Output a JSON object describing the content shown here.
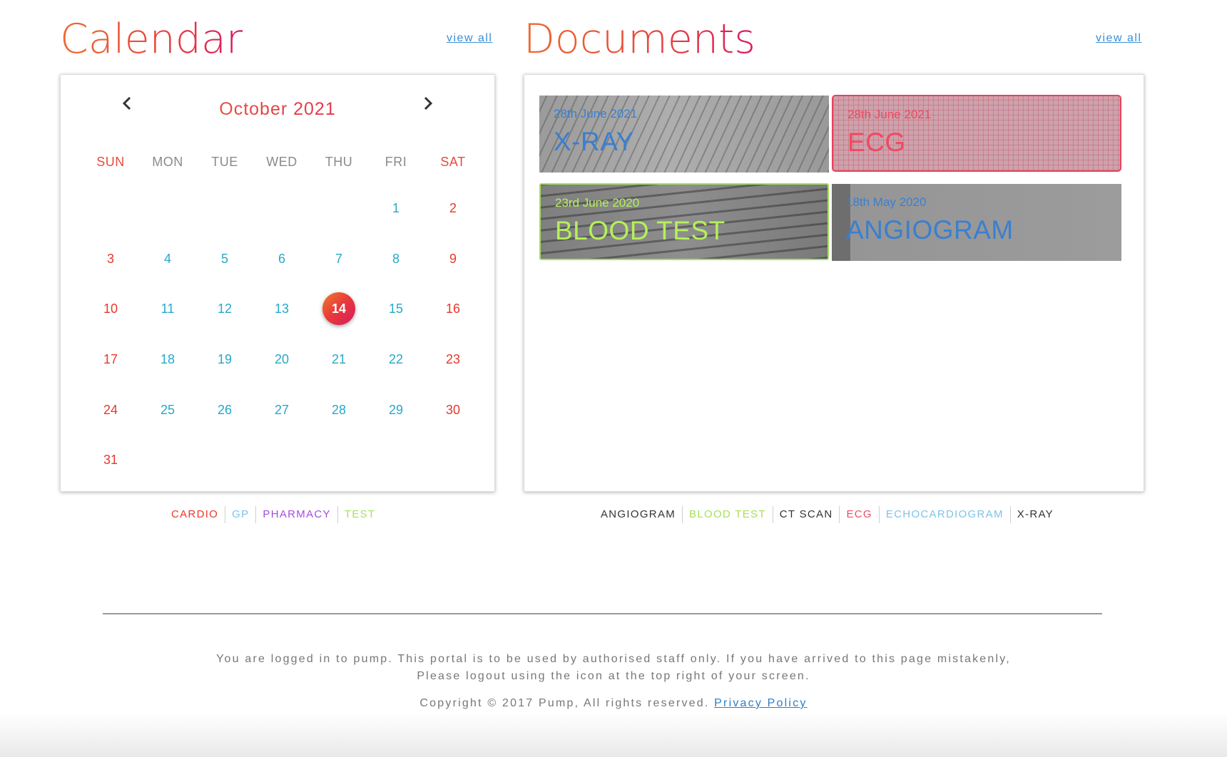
{
  "calendar": {
    "title": "Calendar",
    "view_all": "view all",
    "month_label": "October 2021",
    "prev_icon": "chevron-left-icon",
    "next_icon": "chevron-right-icon",
    "weekdays": [
      "SUN",
      "MON",
      "TUE",
      "WED",
      "THU",
      "FRI",
      "SAT"
    ],
    "weeks": [
      [
        "",
        "",
        "",
        "",
        "",
        "1",
        "2"
      ],
      [
        "3",
        "4",
        "5",
        "6",
        "7",
        "8",
        "9"
      ],
      [
        "10",
        "11",
        "12",
        "13",
        "14",
        "15",
        "16"
      ],
      [
        "17",
        "18",
        "19",
        "20",
        "21",
        "22",
        "23"
      ],
      [
        "24",
        "25",
        "26",
        "27",
        "28",
        "29",
        "30"
      ],
      [
        "31",
        "",
        "",
        "",
        "",
        "",
        ""
      ]
    ],
    "selected_day": "14",
    "legend": [
      {
        "label": "CARDIO",
        "color": "#e8382a"
      },
      {
        "label": "GP",
        "color": "#7ec3e8"
      },
      {
        "label": "PHARMACY",
        "color": "#a34de0"
      },
      {
        "label": "TEST",
        "color": "#a8e05c"
      }
    ]
  },
  "documents": {
    "title": "Documents",
    "view_all": "view all",
    "items": [
      {
        "date": "28th June 2021",
        "name": "X-RAY",
        "color": "#3a7fd0"
      },
      {
        "date": "28th June 2021",
        "name": "ECG",
        "color": "#f04a60"
      },
      {
        "date": "23rd June 2020",
        "name": "BLOOD TEST",
        "color": "#b5f05a"
      },
      {
        "date": "18th May 2020",
        "name": "ANGIOGRAM",
        "color": "#3a7fd0"
      }
    ],
    "legend": [
      {
        "label": "ANGIOGRAM",
        "color": "#333333"
      },
      {
        "label": "BLOOD TEST",
        "color": "#a8e05c"
      },
      {
        "label": "CT SCAN",
        "color": "#333333"
      },
      {
        "label": "ECG",
        "color": "#f04a60"
      },
      {
        "label": "ECHOCARDIOGRAM",
        "color": "#7ec3e8"
      },
      {
        "label": "X-RAY",
        "color": "#333333"
      }
    ]
  },
  "footer": {
    "notice_line1": "You are logged in to pump. This portal is to be used by authorised staff only. If you have arrived to this page mistakenly,",
    "notice_line2": "Please logout using the icon at the top right of your screen.",
    "copyright": "Copyright © 2017 Pump, All rights reserved.",
    "privacy_link": "Privacy Policy"
  }
}
